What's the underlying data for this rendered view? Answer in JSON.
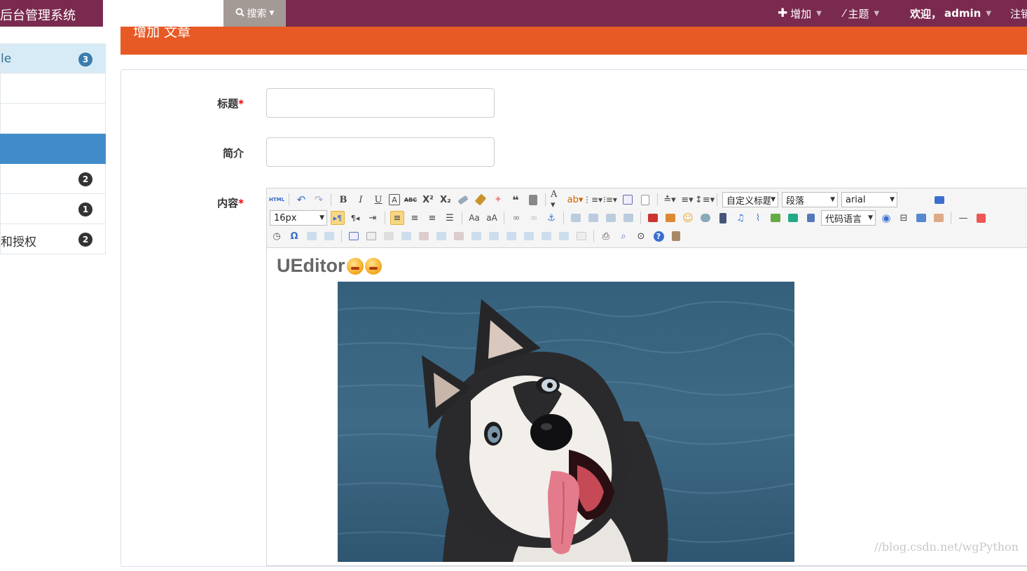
{
  "navbar": {
    "brand": "后台管理系统",
    "search_placeholder": "",
    "search_button": "搜索",
    "add_menu": "增加",
    "theme_menu": "主题",
    "welcome_prefix": "欢迎，",
    "username": "admin",
    "logout": "注销"
  },
  "sidebar": {
    "items": [
      {
        "label": "le",
        "badge": "3"
      },
      {
        "label": "",
        "badge": ""
      },
      {
        "label": "",
        "badge": ""
      },
      {
        "label": "",
        "badge": ""
      },
      {
        "label": "",
        "badge": "2"
      },
      {
        "label": "",
        "badge": "1"
      },
      {
        "label": "和授权",
        "badge": "2"
      }
    ]
  },
  "page": {
    "header_title": "增加 文章"
  },
  "form": {
    "title_label": "标题",
    "summary_label": "简介",
    "content_label": "内容",
    "required_mark": "*",
    "title_value": "",
    "summary_value": ""
  },
  "editor": {
    "font_size": "16px",
    "custom_title": "自定义标题",
    "paragraph": "段落",
    "font_family": "arial",
    "code_language": "代码语言",
    "content_heading": "UEditor"
  },
  "watermark": "//blog.csdn.net/wgPython",
  "colors": {
    "navbar": "#7a2a4e",
    "page_header": "#e85a25",
    "sidebar_active": "#428bca",
    "sidebar_active_top": "#d7ebf7"
  }
}
